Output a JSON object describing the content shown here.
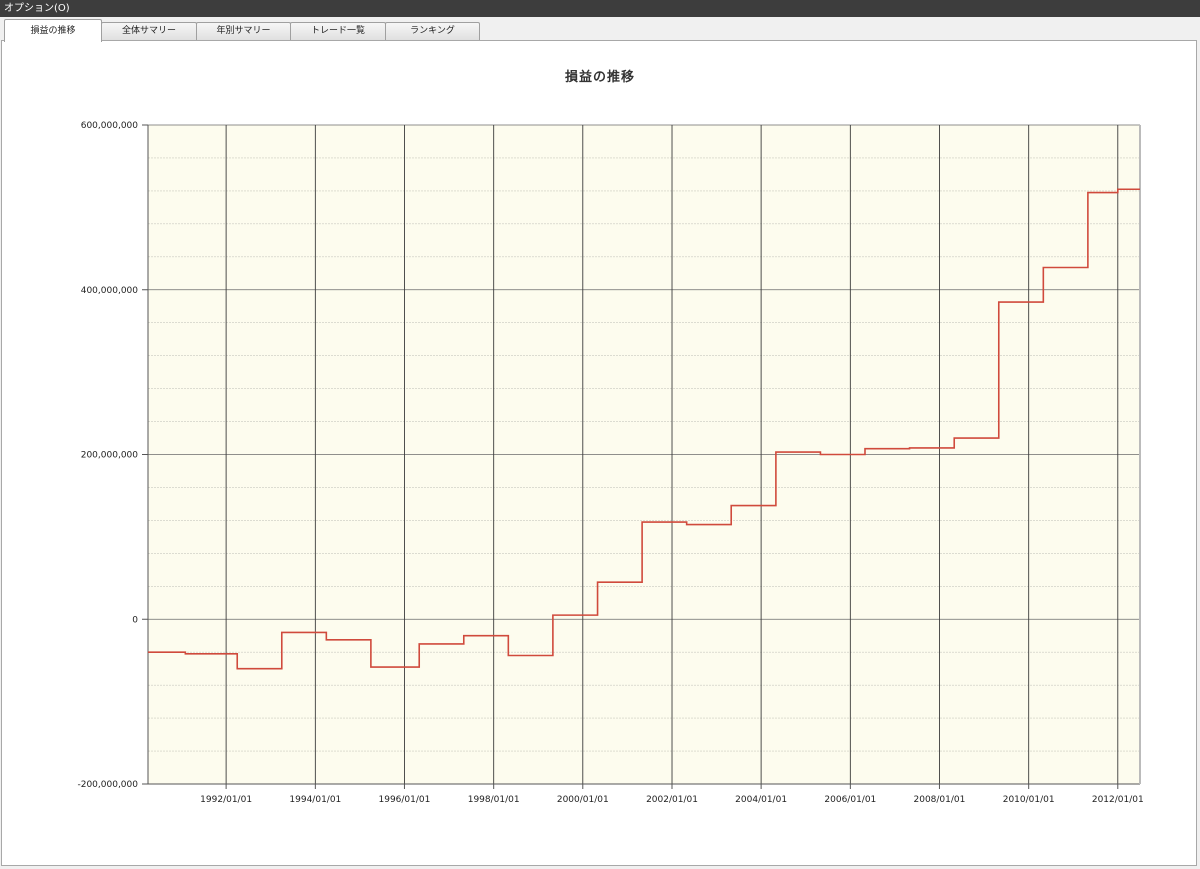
{
  "window": {
    "title": "オプション(O)"
  },
  "tabs": [
    {
      "label": "損益の推移",
      "active": true
    },
    {
      "label": "全体サマリー",
      "active": false
    },
    {
      "label": "年別サマリー",
      "active": false
    },
    {
      "label": "トレード一覧",
      "active": false
    },
    {
      "label": "ランキング",
      "active": false
    }
  ],
  "chart_data": {
    "type": "line",
    "title": "損益の推移",
    "xlabel": "",
    "ylabel": "",
    "ylim": [
      -200000000,
      600000000
    ],
    "xlim": [
      "1990-04-01",
      "2012-07-01"
    ],
    "y_ticks": [
      "600,000,000",
      "400,000,000",
      "200,000,000",
      "0",
      "-200,000,000"
    ],
    "y_tick_values": [
      600000000,
      400000000,
      200000000,
      0,
      -200000000
    ],
    "x_ticks": [
      "1992/01/01",
      "1994/01/01",
      "1996/01/01",
      "1998/01/01",
      "2000/01/01",
      "2002/01/01",
      "2004/01/01",
      "2006/01/01",
      "2008/01/01",
      "2010/01/01",
      "2012/01/01"
    ],
    "x_tick_values": [
      "1992-01-01",
      "1994-01-01",
      "1996-01-01",
      "1998-01-01",
      "2000-01-01",
      "2002-01-01",
      "2004-01-01",
      "2006-01-01",
      "2008-01-01",
      "2010-01-01",
      "2012-01-01"
    ],
    "grid": true,
    "background_color": "#fdfcee",
    "series": [
      {
        "color": "#d04a3c",
        "step": true,
        "points": [
          [
            "1990-04-01",
            -40000000
          ],
          [
            "1991-02-01",
            -42000000
          ],
          [
            "1992-04-01",
            -60000000
          ],
          [
            "1993-04-01",
            -16000000
          ],
          [
            "1994-04-01",
            -25000000
          ],
          [
            "1995-04-01",
            -58000000
          ],
          [
            "1996-05-01",
            -30000000
          ],
          [
            "1997-05-01",
            -20000000
          ],
          [
            "1998-05-01",
            -44000000
          ],
          [
            "1999-05-01",
            5000000
          ],
          [
            "2000-05-01",
            45000000
          ],
          [
            "2001-05-01",
            118000000
          ],
          [
            "2002-05-01",
            115000000
          ],
          [
            "2003-05-01",
            138000000
          ],
          [
            "2004-05-01",
            203000000
          ],
          [
            "2005-05-01",
            200000000
          ],
          [
            "2006-05-01",
            207000000
          ],
          [
            "2007-05-01",
            208000000
          ],
          [
            "2008-05-01",
            220000000
          ],
          [
            "2009-05-01",
            385000000
          ],
          [
            "2010-05-01",
            427000000
          ],
          [
            "2011-05-01",
            518000000
          ],
          [
            "2012-01-01",
            522000000
          ],
          [
            "2012-07-01",
            522000000
          ]
        ]
      }
    ]
  }
}
